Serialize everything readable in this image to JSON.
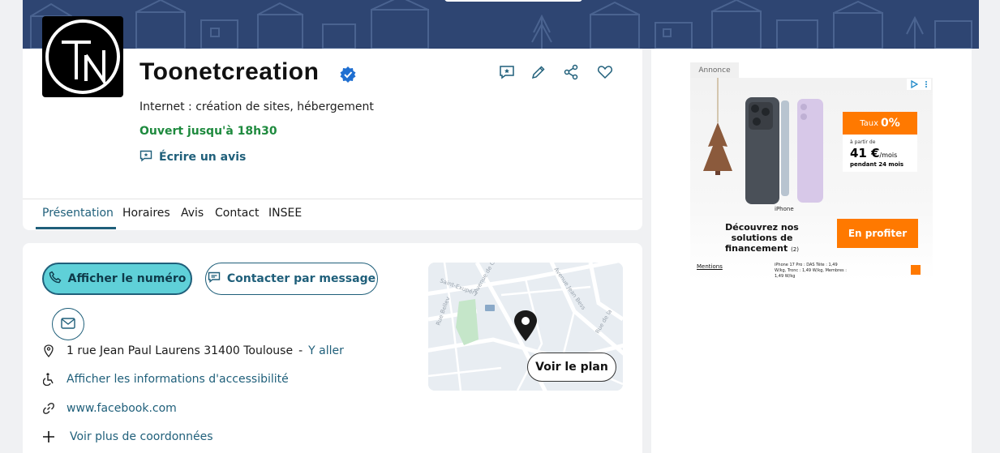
{
  "business": {
    "name": "Toonetcreation",
    "category": "Internet : création de sites, hébergement",
    "hours_status": "Ouvert jusqu'à 18h30",
    "write_review": "Écrire un avis"
  },
  "tabs": [
    {
      "label": "Présentation"
    },
    {
      "label": "Horaires"
    },
    {
      "label": "Avis"
    },
    {
      "label": "Contact"
    },
    {
      "label": "INSEE"
    }
  ],
  "contact": {
    "show_number": "Afficher le numéro",
    "message": "Contacter par message",
    "address": "1 rue Jean Paul Laurens 31400 Toulouse",
    "address_sep": "-",
    "go": "Y aller",
    "accessibility": "Afficher les informations d'accessibilité",
    "website": "www.facebook.com",
    "more": "Voir plus de coordonnées"
  },
  "map": {
    "button": "Voir le plan"
  },
  "ad": {
    "label": "Annonce",
    "rate_prefix": "Taux",
    "rate": "0%",
    "from": "à partir de",
    "price": "41 €",
    "price_unit": "/mois",
    "duration": "pendant 24 mois",
    "device": "iPhone",
    "headline": "Découvrez nos solutions de financement",
    "headline_note": "(2)",
    "cta": "En profiter",
    "mentions": "Mentions",
    "footer": "iPhone 17 Pro : DAS Tête : 1,49 W/kg, Tronc : 1,49 W/kg, Membres : 1,49 W/kg"
  },
  "colors": {
    "banner": "#2e4572",
    "accent": "#1f5f7a",
    "open": "#1e8a3e",
    "phone_button": "#5fd0d8",
    "ad_orange": "#ff7900"
  }
}
